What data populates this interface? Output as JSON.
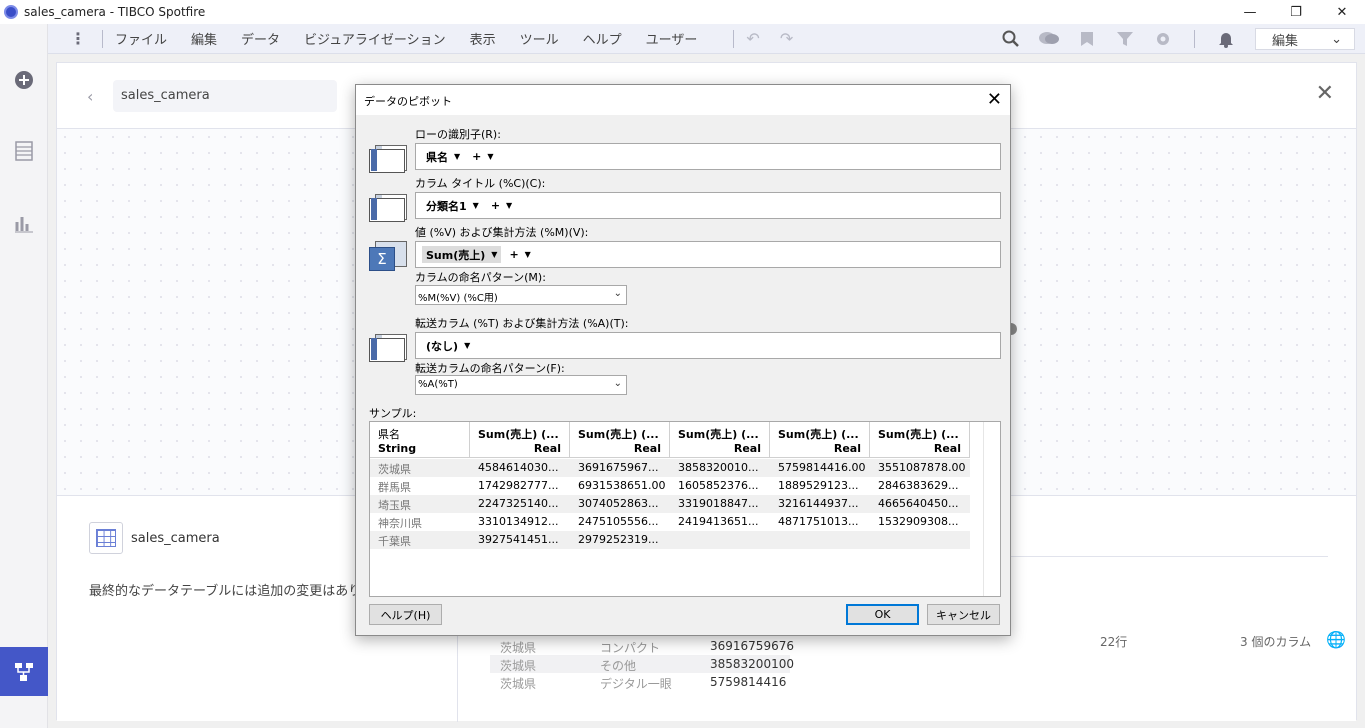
{
  "window": {
    "title": "sales_camera - TIBCO Spotfire",
    "minimize": "—",
    "maximize": "❐",
    "close": "✕"
  },
  "menu": {
    "items": [
      "ファイル",
      "編集",
      "データ",
      "ビジュアライゼーション",
      "表示",
      "ツール",
      "ヘルプ",
      "ユーザー"
    ],
    "mode_select": "編集"
  },
  "panel": {
    "breadcrumb": "sales_camera",
    "table_name": "sales_camera",
    "final_message": "最終的なデータテーブルには追加の変更はありませ",
    "preview_rows": [
      {
        "pref": "茨城県",
        "cat": "コンパクト",
        "value": "36916759676"
      },
      {
        "pref": "茨城県",
        "cat": "その他",
        "value": "38583200100"
      },
      {
        "pref": "茨城県",
        "cat": "デジタル一眼",
        "value": "5759814416"
      }
    ],
    "status_rows": "22行",
    "status_cols": "3 個のカラム"
  },
  "dialog": {
    "title": "データのピボット",
    "row_id_label": "ローの識別子(R):",
    "row_id_chip": "県名",
    "col_title_label": "カラム タイトル (%C)(C):",
    "col_title_chip": "分類名1",
    "values_label": "値 (%V) および集計方法 (%M)(V):",
    "values_chip": "Sum(売上)",
    "plus": "+",
    "naming_label": "カラムの命名パターン(M):",
    "naming_value": "%M(%V) (%C用)",
    "transfer_label": "転送カラム (%T) および集計方法 (%A)(T):",
    "transfer_chip": "(なし)",
    "transfer_naming_label": "転送カラムの命名パターン(F):",
    "transfer_naming_value": "%A(%T)",
    "sample_label": "サンプル:",
    "help_button": "ヘルプ(H)",
    "ok_button": "OK",
    "cancel_button": "キャンセル",
    "sample": {
      "headers": [
        {
          "name": "県名",
          "type": "String"
        },
        {
          "name": "Sum(売上) (...",
          "type": "Real"
        },
        {
          "name": "Sum(売上) (...",
          "type": "Real"
        },
        {
          "name": "Sum(売上) (...",
          "type": "Real"
        },
        {
          "name": "Sum(売上) (...",
          "type": "Real"
        },
        {
          "name": "Sum(売上) (...",
          "type": "Real"
        }
      ],
      "rows": [
        [
          "茨城県",
          "4584614030...",
          "3691675967...",
          "3858320010...",
          "5759814416.00",
          "3551087878.00"
        ],
        [
          "群馬県",
          "1742982777...",
          "6931538651.00",
          "1605852376...",
          "1889529123...",
          "2846383629..."
        ],
        [
          "埼玉県",
          "2247325140...",
          "3074052863...",
          "3319018847...",
          "3216144937...",
          "4665640450..."
        ],
        [
          "神奈川県",
          "3310134912...",
          "2475105556...",
          "2419413651...",
          "4871751013...",
          "1532909308..."
        ],
        [
          "千葉県",
          "3927541451...",
          "2979252319...",
          "",
          "",
          ""
        ]
      ]
    }
  }
}
